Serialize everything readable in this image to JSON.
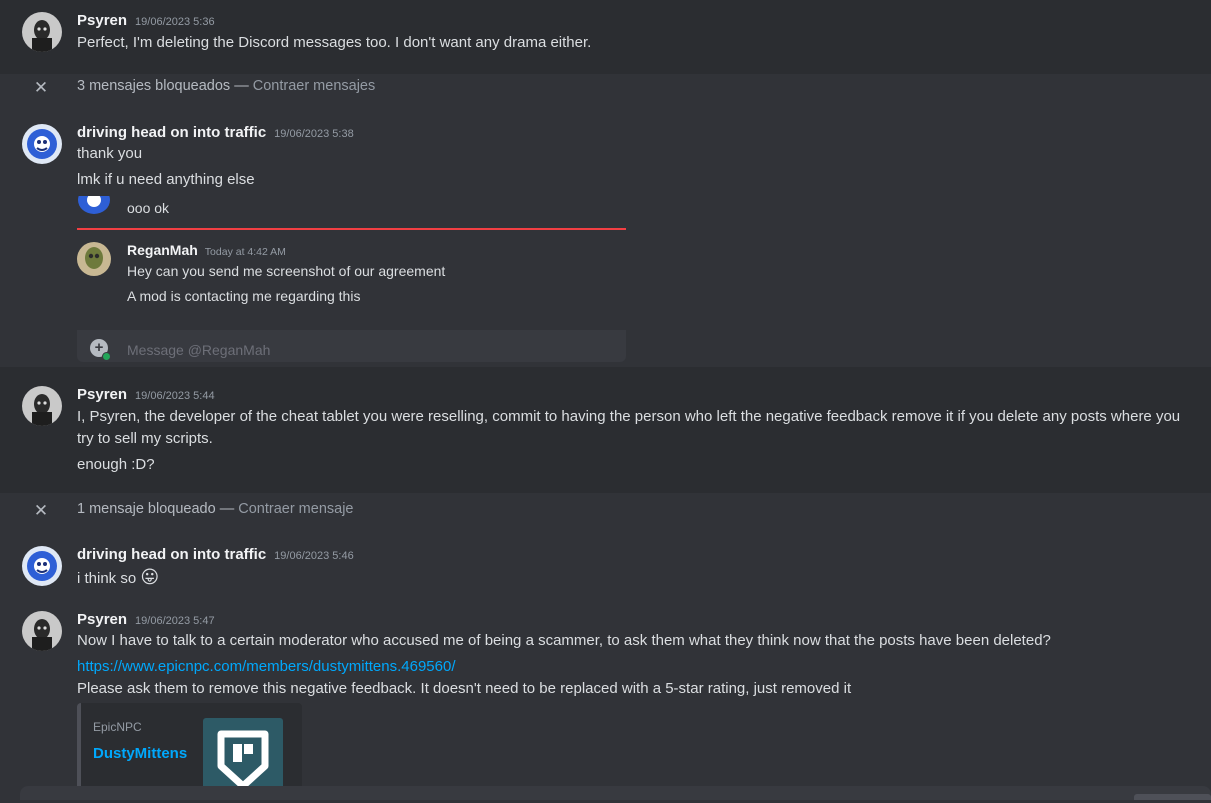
{
  "messages": [
    {
      "author": "Psyren",
      "timestamp": "19/06/2023 5:36",
      "lines": [
        "Perfect, I'm deleting the Discord messages too. I don't want any drama either."
      ]
    },
    {
      "author": "driving head on into traffic",
      "timestamp": "19/06/2023 5:38",
      "lines": [
        "thank you",
        "lmk if u need anything else"
      ]
    },
    {
      "author": "Psyren",
      "timestamp": "19/06/2023 5:44",
      "lines": [
        "I, Psyren, the developer of the cheat tablet you were reselling, commit to having the person who left the negative feedback remove it if you delete any posts where you",
        "try to sell my scripts.",
        "enough :D?"
      ]
    },
    {
      "author": "driving head on into traffic",
      "timestamp": "19/06/2023 5:46",
      "lines": [
        "i think so"
      ],
      "emoji": "😛"
    },
    {
      "author": "Psyren",
      "timestamp": "19/06/2023 5:47",
      "lines": [
        "Now I have to talk to a certain moderator who accused me of being a scammer, to ask them what they think now that the posts have been deleted?",
        "https://www.epicnpc.com/members/dustymittens.469560/",
        "Please ask them to remove this negative feedback. It doesn't need to be replaced with a 5-star rating, just removed it"
      ]
    }
  ],
  "blocked": [
    {
      "text": "3 mensajes bloqueados — ",
      "action": "Contraer mensajes"
    },
    {
      "text": "1 mensaje bloqueado — ",
      "action": "Contraer mensaje"
    }
  ],
  "screenshot": {
    "top_line": "ooo ok",
    "author": "ReganMah",
    "timestamp": "Today at 4:42 AM",
    "lines": [
      "Hey can you send me screenshot of our agreement",
      "A mod is contacting me regarding this"
    ],
    "input_placeholder": "Message @ReganMah"
  },
  "embed": {
    "provider": "EpicNPC",
    "title": "DustyMittens"
  },
  "colors": {
    "background": "#313338",
    "highlight": "#2b2d31",
    "link": "#00a8fc",
    "embed_border": "#4e5058",
    "red_line": "#f23f43",
    "logo_bg": "#2d5a66"
  }
}
